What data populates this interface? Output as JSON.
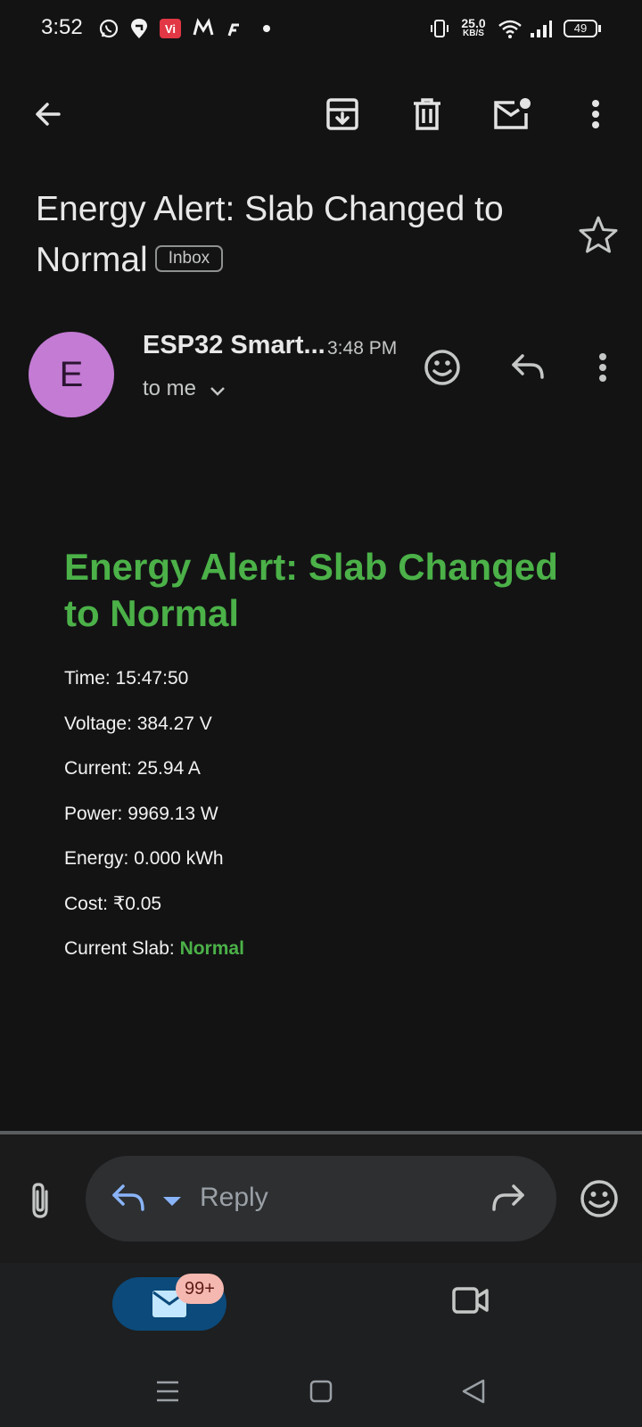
{
  "status_bar": {
    "time": "3:52",
    "net_speed_value": "25.0",
    "net_speed_unit": "KB/S",
    "battery": "49",
    "left_icons": [
      "whatsapp-icon",
      "swiggy-icon",
      "vi-icon",
      "myntra-icon",
      "flipkart-icon",
      "dot-icon"
    ],
    "right_icons": [
      "vibrate-icon",
      "wifi-icon",
      "signal-icon",
      "battery-icon"
    ]
  },
  "app_bar": {
    "icons": [
      "back-arrow-icon",
      "archive-icon",
      "delete-icon",
      "mark-unread-icon",
      "more-vert-icon"
    ]
  },
  "email": {
    "subject": "Energy Alert: Slab Changed to Normal",
    "label": "Inbox",
    "sender_initial": "E",
    "sender_name": "ESP32 Smart...",
    "time": "3:48 PM",
    "recipient": "to me",
    "avatar_color": "#c37bd4",
    "body": {
      "title": "Energy Alert: Slab Changed to Normal",
      "title_color": "#4bb148",
      "fields": [
        {
          "text": "Time: 15:47:50"
        },
        {
          "text": "Voltage: 384.27 V"
        },
        {
          "text": "Current: 25.94 A"
        },
        {
          "text": "Power: 9969.13 W"
        },
        {
          "text": "Energy: 0.000 kWh"
        },
        {
          "text": "Cost: ₹0.05"
        }
      ],
      "slab_label": "Current Slab: ",
      "slab_value": "Normal"
    }
  },
  "reply_bar": {
    "placeholder": "Reply"
  },
  "bottom_nav": {
    "mail_badge": "99+",
    "accent": "#0b4a7a"
  }
}
